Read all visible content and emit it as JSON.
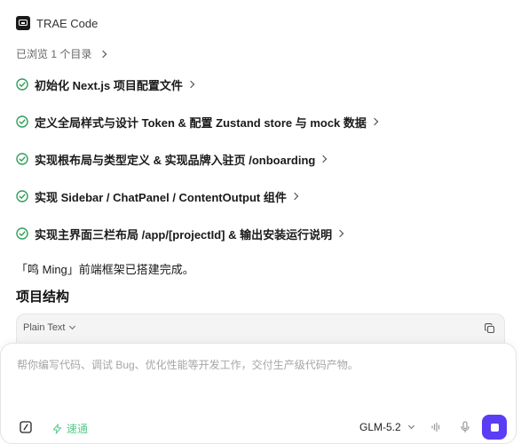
{
  "app": {
    "title": "TRAE Code"
  },
  "browsed": {
    "label": "已浏览 1 个目录"
  },
  "tasks": [
    {
      "label": "初始化 Next.js 项目配置文件"
    },
    {
      "label": "定义全局样式与设计 Token & 配置 Zustand store 与 mock 数据"
    },
    {
      "label": "实现根布局与类型定义 & 实现品牌入驻页 /onboarding"
    },
    {
      "label": "实现 Sidebar / ChatPanel / ContentOutput 组件"
    },
    {
      "label": "实现主界面三栏布局 /app/[projectId] & 输出安装运行说明"
    }
  ],
  "summary": {
    "text": "「鸣 Ming」前端框架已搭建完成。"
  },
  "section": {
    "title": "项目结构"
  },
  "code_block": {
    "language": "Plain Text"
  },
  "composer": {
    "placeholder": "帮你编写代码、调试 Bug、优化性能等开发工作，交付生产级代码产物。",
    "value": "",
    "fast_label": "速通",
    "model": "GLM-5.2"
  },
  "colors": {
    "accent": "#5b3df5",
    "check": "#2f9e5b",
    "fast": "#58c98b"
  },
  "icons": [
    "check-circle-icon",
    "chevron-right-icon",
    "copy-icon",
    "terminal-icon",
    "lightning-icon",
    "voice-wave-icon",
    "microphone-icon",
    "stop-icon"
  ]
}
